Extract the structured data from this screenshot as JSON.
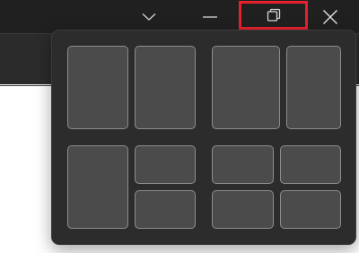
{
  "window_controls": {
    "chevron_icon": "chevron-down-icon",
    "minimize_icon": "minimize-icon",
    "restore_icon": "restore-icon",
    "close_icon": "close-icon",
    "highlight_color": "#e8202e"
  },
  "snap_layouts": {
    "layouts": [
      {
        "id": "half-half",
        "zones": 2
      },
      {
        "id": "two-thirds-one-third",
        "zones": 2
      },
      {
        "id": "half-quarter-quarter",
        "zones": 3
      },
      {
        "id": "four-quadrants",
        "zones": 4
      }
    ],
    "zone_fill": "#4b4b4b",
    "zone_border": "#8d8d8d",
    "panel_fill": "#2c2c2c"
  }
}
